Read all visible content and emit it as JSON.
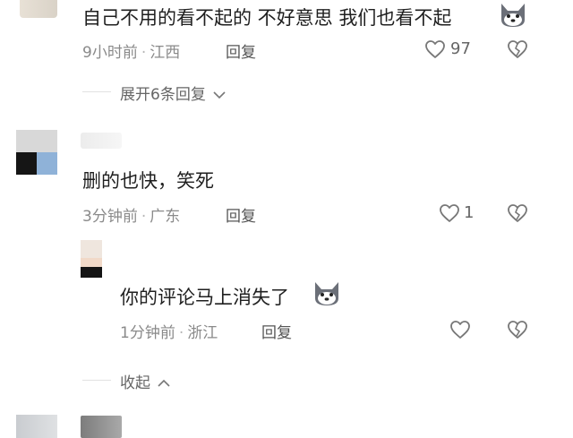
{
  "comments": [
    {
      "text": "自己不用的看不起的 不好意思 我们也看不起",
      "time": "9小时前",
      "location": "江西",
      "reply_label": "回复",
      "likes": "97"
    },
    {
      "text": "删的也快，笑死",
      "time": "3分钟前",
      "location": "广东",
      "reply_label": "回复",
      "likes": "1"
    }
  ],
  "nested_reply": {
    "text": "你的评论马上消失了",
    "time": "1分钟前",
    "location": "浙江",
    "reply_label": "回复"
  },
  "expand_replies_label": "展开6条回复",
  "collapse_label": "收起",
  "colors": {
    "meta": "#8a8a8a",
    "text": "#1f1f1f",
    "divider": "#e2e2e2"
  }
}
